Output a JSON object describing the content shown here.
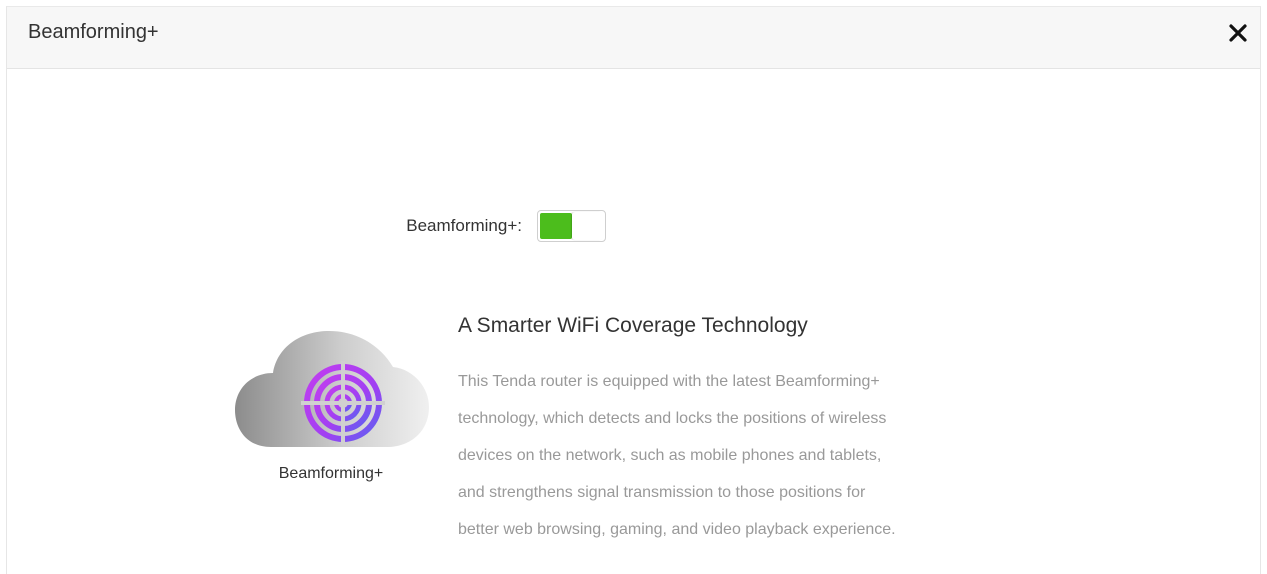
{
  "dialog": {
    "title": "Beamforming+",
    "close_icon": "close-icon"
  },
  "setting": {
    "label": "Beamforming+:",
    "enabled": true,
    "on_color": "#4cbd1c"
  },
  "feature": {
    "icon": "beamforming-cloud-icon",
    "caption": "Beamforming+",
    "heading": "A Smarter WiFi Coverage Technology",
    "description_lines": [
      "This Tenda router is equipped with the latest Beamforming+",
      "technology, which detects and locks the positions of wireless",
      "devices on the network, such as mobile phones and tablets,",
      "and strengthens signal transmission to those positions for",
      "better web browsing, gaming, and video playback experience."
    ]
  }
}
